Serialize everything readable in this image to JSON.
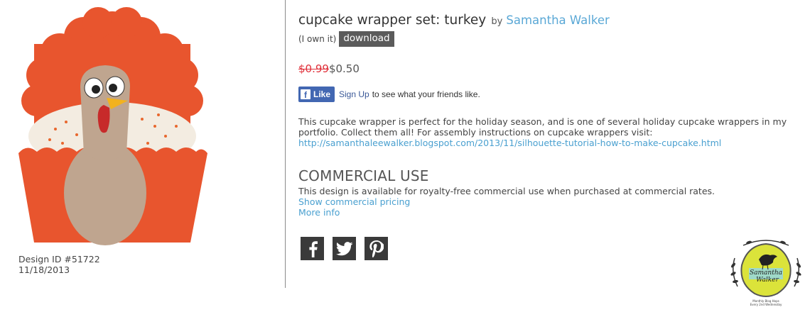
{
  "product": {
    "title": "cupcake wrapper set: turkey",
    "by": "by",
    "author": "Samantha Walker",
    "own_text": "(I own it)",
    "download_label": "download",
    "old_price": "$0.99",
    "new_price": "$0.50"
  },
  "facebook": {
    "like_label": "Like",
    "signup_label": "Sign Up",
    "prompt": "to see what your friends like."
  },
  "description": {
    "text": "This cupcake wrapper is perfect for the holiday season, and is one of several holiday cupcake wrappers in my portfolio. Collect them all! For assembly instructions on cupcake wrappers visit:",
    "link": "http://samanthaleewalker.blogspot.com/2013/11/silhouette-tutorial-how-to-make-cupcake.html"
  },
  "commercial": {
    "heading": "COMMERCIAL USE",
    "text": "This design is available for royalty-free commercial use when purchased at commercial rates.",
    "pricing_link": "Show commercial pricing",
    "more_link": "More info"
  },
  "meta": {
    "design_id": "Design ID #51722",
    "date": "11/18/2013"
  },
  "social": [
    "facebook-icon",
    "twitter-icon",
    "pinterest-icon"
  ],
  "logo": {
    "name_line1": "Samantha",
    "name_line2": "Walker",
    "tag_line1": "Monthly Blog Hops",
    "tag_line2": "Every 2nd Wednesday"
  },
  "colors": {
    "link": "#4aa0d0",
    "old_price": "#e0303a",
    "download_bg": "#5b5b5b",
    "facebook_blue": "#4267b2",
    "wrapper_orange": "#e8552e"
  }
}
